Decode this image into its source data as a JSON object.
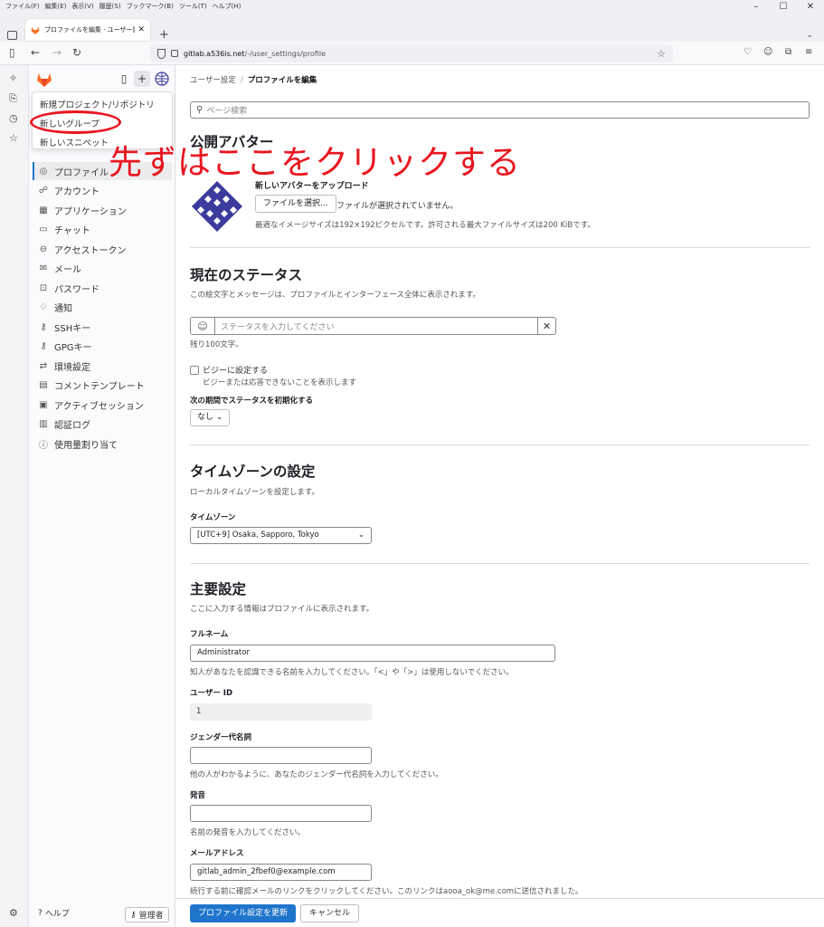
{
  "browser": {
    "menu": [
      "ファイル(F)",
      "編集(E)",
      "表示(V)",
      "履歴(S)",
      "ブックマーク(B)",
      "ツール(T)",
      "ヘルプ(H)"
    ],
    "tab_title": "プロファイルを編集 · ユーザー設定 · G",
    "url_host": "gitlab.a536is.net",
    "url_path": "/-/user_settings/profile"
  },
  "sidebar": {
    "items": [
      {
        "icon": "user-icon",
        "label": "プロファイル",
        "active": true
      },
      {
        "icon": "account-icon",
        "label": "アカウント"
      },
      {
        "icon": "applications-icon",
        "label": "アプリケーション"
      },
      {
        "icon": "chat-icon",
        "label": "チャット"
      },
      {
        "icon": "token-icon",
        "label": "アクセストークン"
      },
      {
        "icon": "mail-icon",
        "label": "メール"
      },
      {
        "icon": "lock-icon",
        "label": "パスワード"
      },
      {
        "icon": "bell-icon",
        "label": "通知"
      },
      {
        "icon": "key-icon",
        "label": "SSHキー"
      },
      {
        "icon": "key-icon",
        "label": "GPGキー"
      },
      {
        "icon": "preferences-icon",
        "label": "環境設定"
      },
      {
        "icon": "comment-icon",
        "label": "コメントテンプレート"
      },
      {
        "icon": "monitor-icon",
        "label": "アクティブセッション"
      },
      {
        "icon": "log-icon",
        "label": "認証ログ"
      },
      {
        "icon": "quota-icon",
        "label": "使用量割り当て"
      }
    ],
    "help_label": "ヘルプ",
    "admin_label": "管理者"
  },
  "dropdown": {
    "items": [
      "新規プロジェクト/リポジトリ",
      "新しいグループ",
      "新しいスニペット"
    ]
  },
  "annotation": {
    "text": "先ずはここをクリックする",
    "color": "#e8161f"
  },
  "breadcrumb": {
    "parent": "ユーザー設定",
    "current": "プロファイルを編集"
  },
  "search": {
    "placeholder": "ページ検索"
  },
  "public_avatar": {
    "title": "公開アバター",
    "upload_title": "新しいアバターをアップロード",
    "file_button": "ファイルを選択...",
    "file_none": "ファイルが選択されていません。",
    "hint": "最適なイメージサイズは192×192ピクセルです。許可される最大ファイルサイズは200 KiBです。"
  },
  "status": {
    "title": "現在のステータス",
    "desc": "この絵文字とメッセージは、プロファイルとインターフェース全体に表示されます。",
    "placeholder": "ステータスを入力してください",
    "remaining": "残り100文字。",
    "busy_label": "ビジーに設定する",
    "busy_help": "ビジーまたは応答できないことを表示します",
    "clear_label": "次の期間でステータスを初期化する",
    "clear_value": "なし"
  },
  "timezone": {
    "title": "タイムゾーンの設定",
    "desc": "ローカルタイムゾーンを設定します。",
    "label": "タイムゾーン",
    "value": "[UTC+9] Osaka, Sapporo, Tokyo"
  },
  "main_settings": {
    "title": "主要設定",
    "desc": "ここに入力する情報はプロファイルに表示されます。",
    "full_name_label": "フルネーム",
    "full_name_value": "Administrator",
    "full_name_help": "知人があなたを認識できる名前を入力してください。「<」や「>」は使用しないでください。",
    "user_id_label": "ユーザー ID",
    "user_id_value": "1",
    "pronouns_label": "ジェンダー代名詞",
    "pronouns_help": "他の人がわかるように、あなたのジェンダー代名詞を入力してください。",
    "pronunciation_label": "発音",
    "pronunciation_help": "名前の発音を入力してください。",
    "email_label": "メールアドレス",
    "email_value": "gitlab_admin_2fbef0@example.com",
    "email_help": "続行する前に確認メールのリンクをクリックしてください。このリンクはaooa_ok@me.comに送信されました。"
  },
  "actions": {
    "save": "プロファイル設定を更新",
    "cancel": "キャンセル"
  },
  "colors": {
    "accent": "#1f75cb",
    "annotation": "#e8161f",
    "logo": "#fc6d26"
  }
}
